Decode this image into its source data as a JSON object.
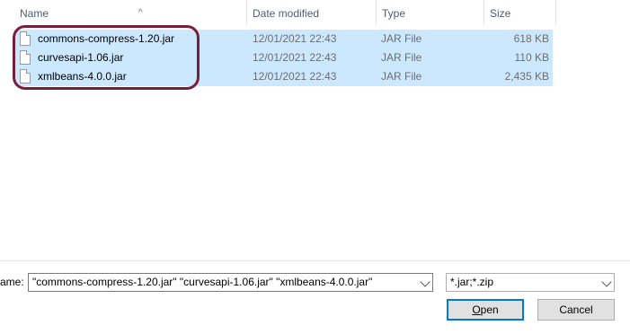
{
  "columns": {
    "name": "Name",
    "date_modified": "Date modified",
    "type": "Type",
    "size": "Size"
  },
  "files": [
    {
      "name": "commons-compress-1.20.jar",
      "date": "12/01/2021 22:43",
      "type": "JAR File",
      "size": "618 KB"
    },
    {
      "name": "curvesapi-1.06.jar",
      "date": "12/01/2021 22:43",
      "type": "JAR File",
      "size": "110 KB"
    },
    {
      "name": "xmlbeans-4.0.0.jar",
      "date": "12/01/2021 22:43",
      "type": "JAR File",
      "size": "2,435 KB"
    }
  ],
  "footer": {
    "filename_label": "ame:",
    "filename_value": "\"commons-compress-1.20.jar\" \"curvesapi-1.06.jar\" \"xmlbeans-4.0.0.jar\"",
    "filter_value": "*.jar;*.zip",
    "open_label_first": "O",
    "open_label_rest": "pen",
    "cancel_label": "Cancel"
  },
  "colors": {
    "selection": "#cce8ff",
    "highlight_ring": "#7a1f3a",
    "default_button_border": "#0078d7"
  },
  "icons": [
    "sort-up-icon",
    "file-icon",
    "chevron-down-icon"
  ]
}
